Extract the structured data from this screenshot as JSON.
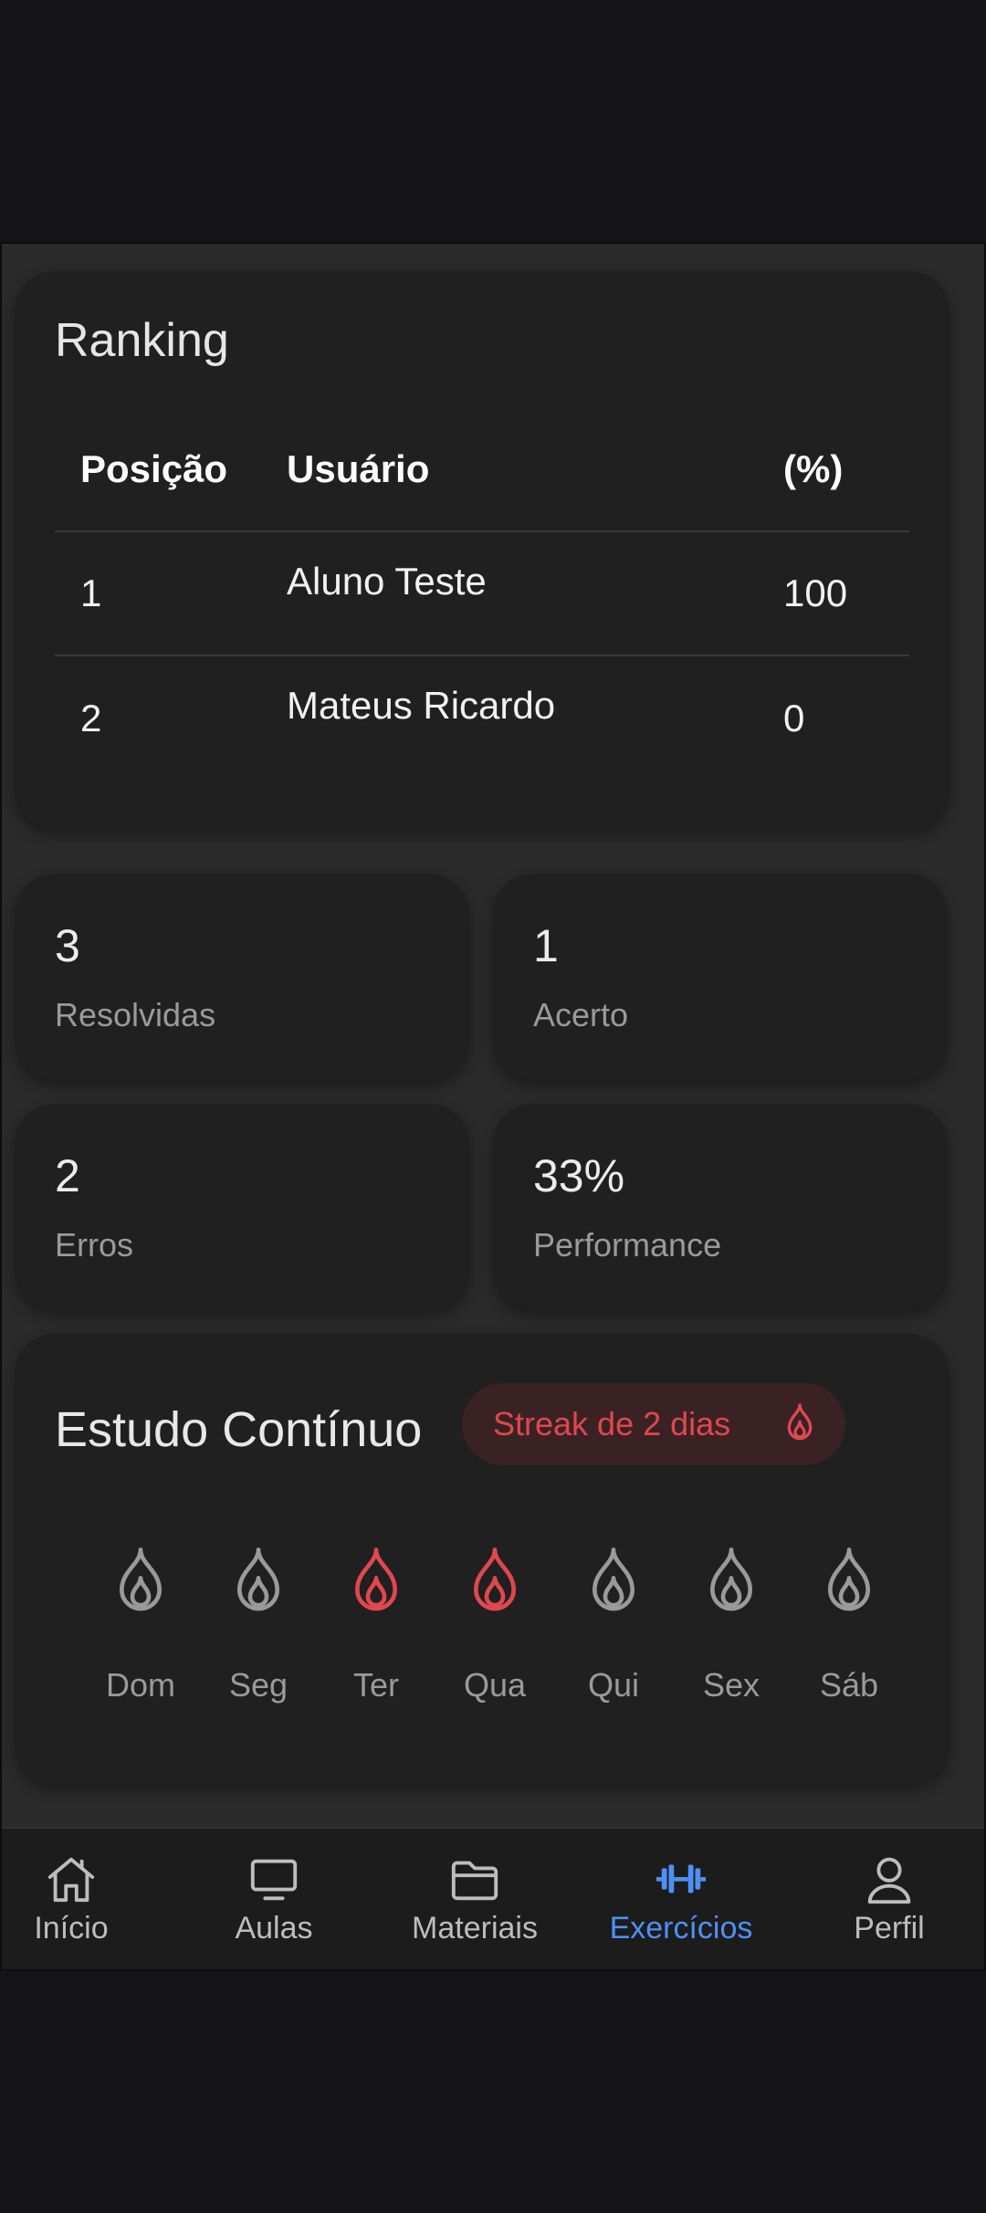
{
  "ranking": {
    "title": "Ranking",
    "headers": {
      "position": "Posição",
      "user": "Usuário",
      "percent": "(%)"
    },
    "rows": [
      {
        "position": "1",
        "user": "Aluno Teste",
        "percent": "100"
      },
      {
        "position": "2",
        "user": "Mateus Ricardo",
        "percent": "0"
      }
    ]
  },
  "stats": [
    {
      "value": "3",
      "label": "Resolvidas"
    },
    {
      "value": "1",
      "label": "Acerto"
    },
    {
      "value": "2",
      "label": "Erros"
    },
    {
      "value": "33%",
      "label": "Performance"
    }
  ],
  "streak": {
    "title": "Estudo Contínuo",
    "badge": "Streak de 2 dias",
    "days": [
      {
        "label": "Dom",
        "active": false
      },
      {
        "label": "Seg",
        "active": false
      },
      {
        "label": "Ter",
        "active": true
      },
      {
        "label": "Qua",
        "active": true
      },
      {
        "label": "Qui",
        "active": false
      },
      {
        "label": "Sex",
        "active": false
      },
      {
        "label": "Sáb",
        "active": false
      }
    ],
    "colors": {
      "active": "#e0474f",
      "inactive": "#9a9a9a"
    }
  },
  "nav": {
    "items": [
      {
        "label": "Início",
        "icon": "home-icon"
      },
      {
        "label": "Aulas",
        "icon": "monitor-icon"
      },
      {
        "label": "Materiais",
        "icon": "folder-icon"
      },
      {
        "label": "Exercícios",
        "icon": "dumbbell-icon",
        "active": true
      },
      {
        "label": "Perfil",
        "icon": "person-icon"
      }
    ],
    "colors": {
      "active": "#4f8ff7",
      "inactive": "#bdbdbd"
    }
  }
}
